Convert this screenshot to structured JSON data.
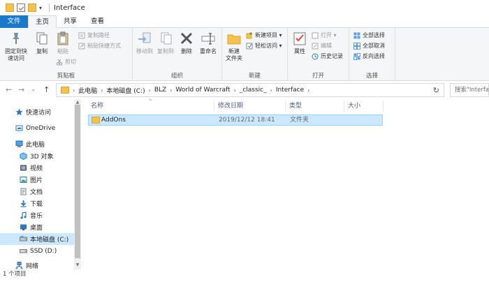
{
  "window": {
    "title": "Interface"
  },
  "quick_access": {
    "dropdown_glyph": "▾"
  },
  "tabs": [
    {
      "label": "文件"
    },
    {
      "label": "主页"
    },
    {
      "label": "共享"
    },
    {
      "label": "查看"
    }
  ],
  "ribbon": {
    "clipboard": {
      "label": "剪贴板",
      "pin_label_1": "固定到快",
      "pin_label_2": "速访问",
      "copy_label": "复制",
      "paste_label": "粘贴",
      "copy_path_label": "复制路径",
      "paste_shortcut_label": "粘贴快捷方式",
      "cut_label": "剪切"
    },
    "organize": {
      "label": "组织",
      "move_to_label": "移动到",
      "copy_to_label": "复制到",
      "delete_label": "删除",
      "rename_label": "重命名"
    },
    "new": {
      "label": "新建",
      "new_folder_label_1": "新建",
      "new_folder_label_2": "文件夹",
      "new_item_label": "新建项目 ▾",
      "easy_access_label": "轻松访问 ▾"
    },
    "open": {
      "label": "打开",
      "properties_label": "属性",
      "open_label": "打开 ▾",
      "edit_label": "编辑",
      "history_label": "历史记录"
    },
    "select": {
      "label": "选择",
      "select_all_label": "全部选择",
      "select_none_label": "全部取消",
      "invert_label": "反向选择"
    }
  },
  "nav": {
    "back_glyph": "←",
    "forward_glyph": "→",
    "recent_glyph": "⌄",
    "up_glyph": "↑",
    "refresh_glyph": "↻",
    "breadcrumb": [
      "此电脑",
      "本地磁盘 (C:)",
      "BLZ",
      "World of Warcraft",
      "_classic_",
      "Interface"
    ],
    "search_placeholder": "搜索\"Interface\""
  },
  "navpane": {
    "items": [
      {
        "label": "快速访问",
        "icon": "star-icon"
      },
      {
        "label": "OneDrive",
        "icon": "cloud-icon"
      },
      {
        "label": "此电脑",
        "icon": "computer-icon"
      },
      {
        "label": "3D 对象",
        "icon": "cube-icon"
      },
      {
        "label": "视频",
        "icon": "video-icon"
      },
      {
        "label": "图片",
        "icon": "picture-icon"
      },
      {
        "label": "文档",
        "icon": "document-icon"
      },
      {
        "label": "下载",
        "icon": "download-icon"
      },
      {
        "label": "音乐",
        "icon": "music-icon"
      },
      {
        "label": "桌面",
        "icon": "desktop-icon"
      },
      {
        "label": "本地磁盘 (C:)",
        "icon": "drive-icon"
      },
      {
        "label": "SSD (D:)",
        "icon": "drive-icon"
      },
      {
        "label": "网络",
        "icon": "network-icon"
      }
    ]
  },
  "filelist": {
    "columns": [
      "名称",
      "修改日期",
      "类型",
      "大小"
    ],
    "rows": [
      {
        "name": "AddOns",
        "modified": "2019/12/12 18:41",
        "type": "文件夹",
        "size": ""
      }
    ]
  },
  "status": {
    "text": "1 个项目"
  },
  "colors": {
    "accent": "#1979ca",
    "selection": "#cce8ff",
    "folder": "#f3c14d"
  }
}
